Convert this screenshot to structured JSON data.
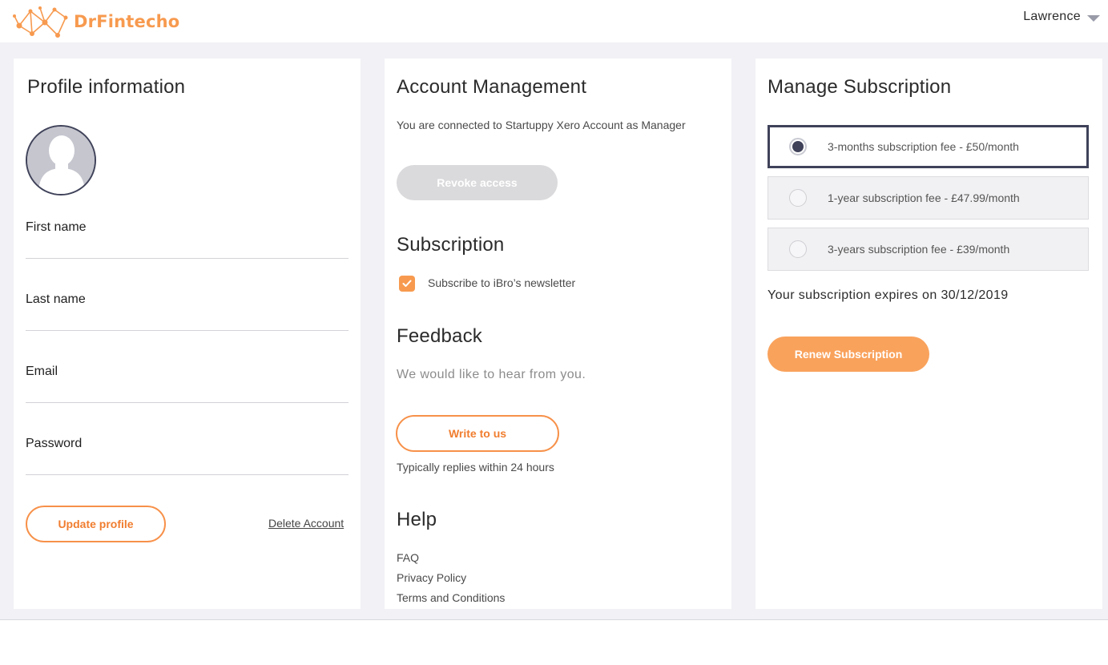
{
  "header": {
    "logo_text": "DrFintecho",
    "user_name": "Lawrence",
    "brand_color": "#f79a4f"
  },
  "profile": {
    "title": "Profile information",
    "fields": {
      "first_name": {
        "label": "First name",
        "value": ""
      },
      "last_name": {
        "label": "Last name",
        "value": ""
      },
      "email": {
        "label": "Email",
        "value": ""
      },
      "password": {
        "label": "Password",
        "value": ""
      }
    },
    "update_button": "Update profile",
    "delete_link": "Delete Account"
  },
  "account": {
    "title": "Account Management",
    "connection_text": "You are connected to Startuppy Xero Account as Manager",
    "revoke_button": "Revoke access",
    "subscription_title": "Subscription",
    "newsletter_label": "Subscribe to iBro’s newsletter",
    "newsletter_checked": true,
    "feedback_title": "Feedback",
    "feedback_text": "We would like to hear from you.",
    "write_button": "Write to us",
    "reply_note": "Typically replies within 24 hours",
    "help_title": "Help",
    "help_links": [
      "FAQ",
      "Privacy Policy",
      "Terms and Conditions"
    ]
  },
  "subscription": {
    "title": "Manage Subscription",
    "options": [
      {
        "label": "3-months subscription fee - £50/month",
        "selected": true
      },
      {
        "label": "1-year subscription fee - £47.99/month",
        "selected": false
      },
      {
        "label": "3-years subscription fee - £39/month",
        "selected": false
      }
    ],
    "expiry_text": "Your subscription expires on 30/12/2019",
    "renew_button": "Renew Subscription"
  }
}
